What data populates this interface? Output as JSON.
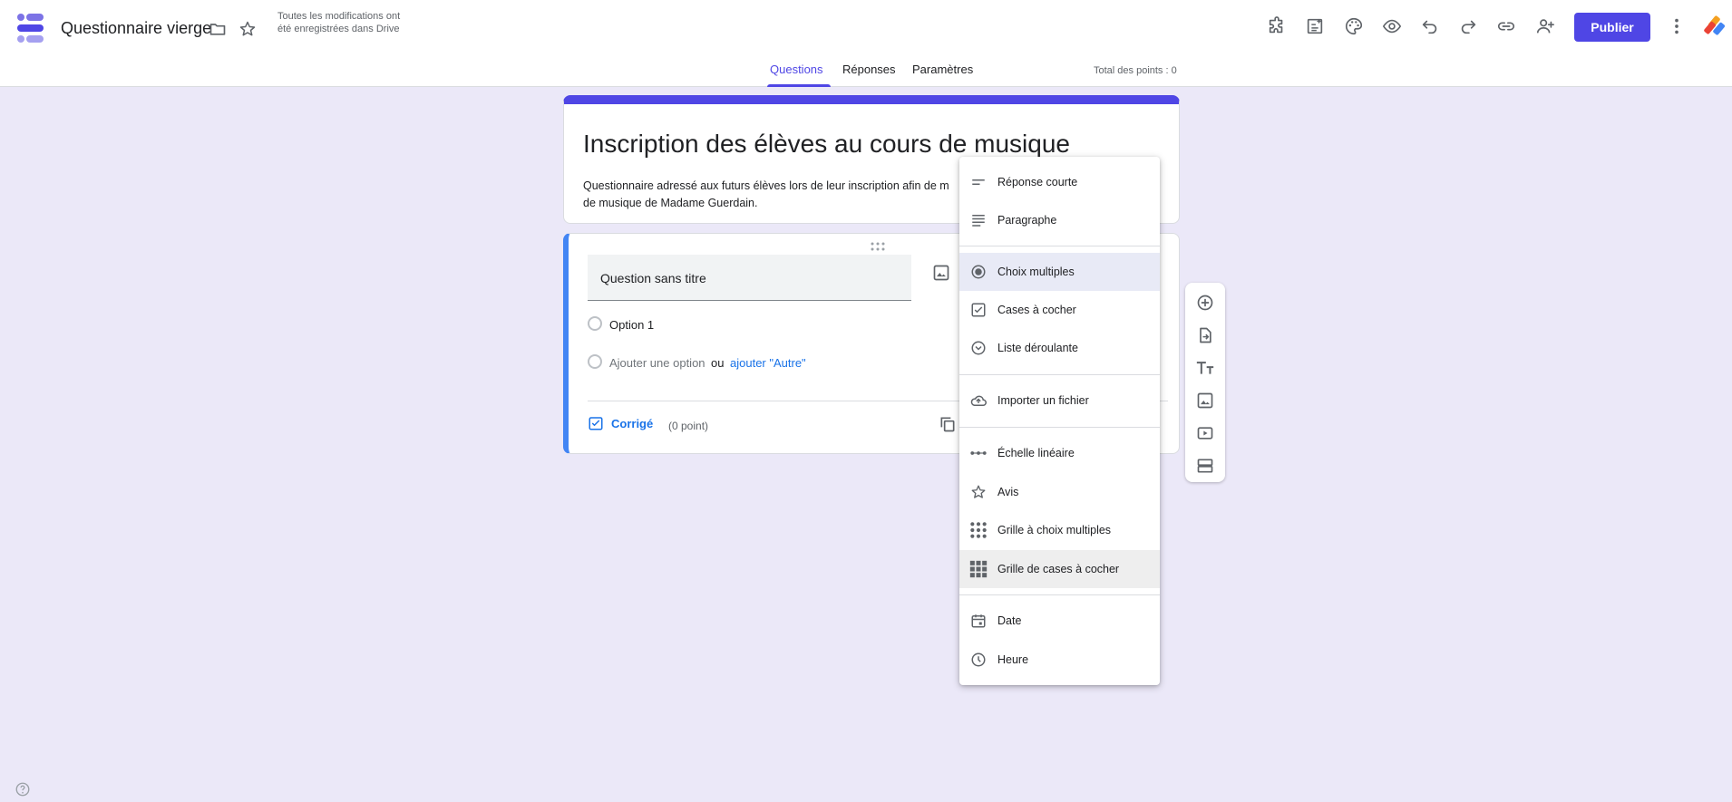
{
  "header": {
    "doc_title": "Questionnaire vierge",
    "save_status": "Toutes les modifications ont été enregistrées dans Drive",
    "publish_label": "Publier",
    "points_total": "Total des points : 0",
    "accent_color": "#4f46e5"
  },
  "tabs": [
    {
      "label": "Questions",
      "active": true
    },
    {
      "label": "Réponses",
      "active": false
    },
    {
      "label": "Paramètres",
      "active": false
    }
  ],
  "form": {
    "title": "Inscription des élèves au cours de musique",
    "description": "Questionnaire adressé aux futurs élèves lors de leur inscription afin de m... de musique de Madame Guerdain.",
    "description_line1": "Questionnaire adressé aux futurs élèves lors de leur inscription afin de m",
    "description_line2": "de musique de Madame Guerdain."
  },
  "question": {
    "title": "Question sans titre",
    "option1": "Option 1",
    "add_option": "Ajouter une option",
    "or": "ou",
    "add_other": "ajouter \"Autre\"",
    "answer_key": "Corrigé",
    "points": "(0 point)"
  },
  "type_menu": {
    "items": [
      {
        "label": "Réponse courte",
        "icon": "short-answer-icon"
      },
      {
        "label": "Paragraphe",
        "icon": "paragraph-icon"
      },
      {
        "label": "Choix multiples",
        "icon": "radio-icon",
        "selected": true
      },
      {
        "label": "Cases à cocher",
        "icon": "checkbox-icon"
      },
      {
        "label": "Liste déroulante",
        "icon": "dropdown-icon"
      },
      {
        "label": "Importer un fichier",
        "icon": "cloud-upload-icon"
      },
      {
        "label": "Échelle linéaire",
        "icon": "linear-scale-icon"
      },
      {
        "label": "Avis",
        "icon": "star-icon"
      },
      {
        "label": "Grille à choix multiples",
        "icon": "grid-dots-icon"
      },
      {
        "label": "Grille de cases à cocher",
        "icon": "grid-squares-icon",
        "hovered": true
      },
      {
        "label": "Date",
        "icon": "calendar-icon"
      },
      {
        "label": "Heure",
        "icon": "clock-icon"
      }
    ]
  },
  "side_toolbar": [
    "add-question-icon",
    "import-questions-icon",
    "add-title-icon",
    "add-image-icon",
    "add-video-icon",
    "add-section-icon"
  ]
}
